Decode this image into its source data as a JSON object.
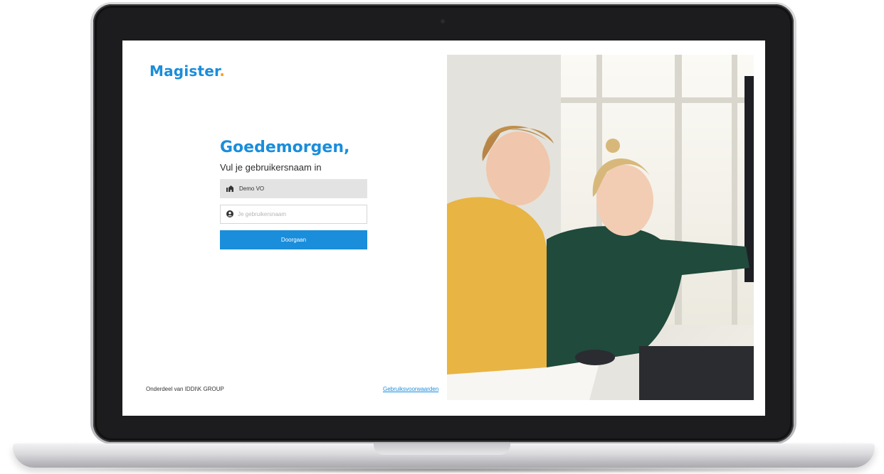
{
  "app": {
    "logo_text": "Magister",
    "logo_dot": ".",
    "brand_color": "#1a8ddb",
    "accent_color": "#f7a21b"
  },
  "login": {
    "greeting": "Goedemorgen,",
    "subtitle": "Vul je gebruikersnaam in",
    "school_name": "Demo VO",
    "school_icon": "school-icon",
    "username_placeholder": "Je gebruikersnaam",
    "username_value": "",
    "user_icon": "user-icon",
    "submit_label": "Doorgaan"
  },
  "footer": {
    "left_text": "Onderdeel van IDDI\\K GROUP",
    "terms_link": "Gebruiksvoorwaarden"
  },
  "hero": {
    "image": "students-at-computer-photo"
  }
}
